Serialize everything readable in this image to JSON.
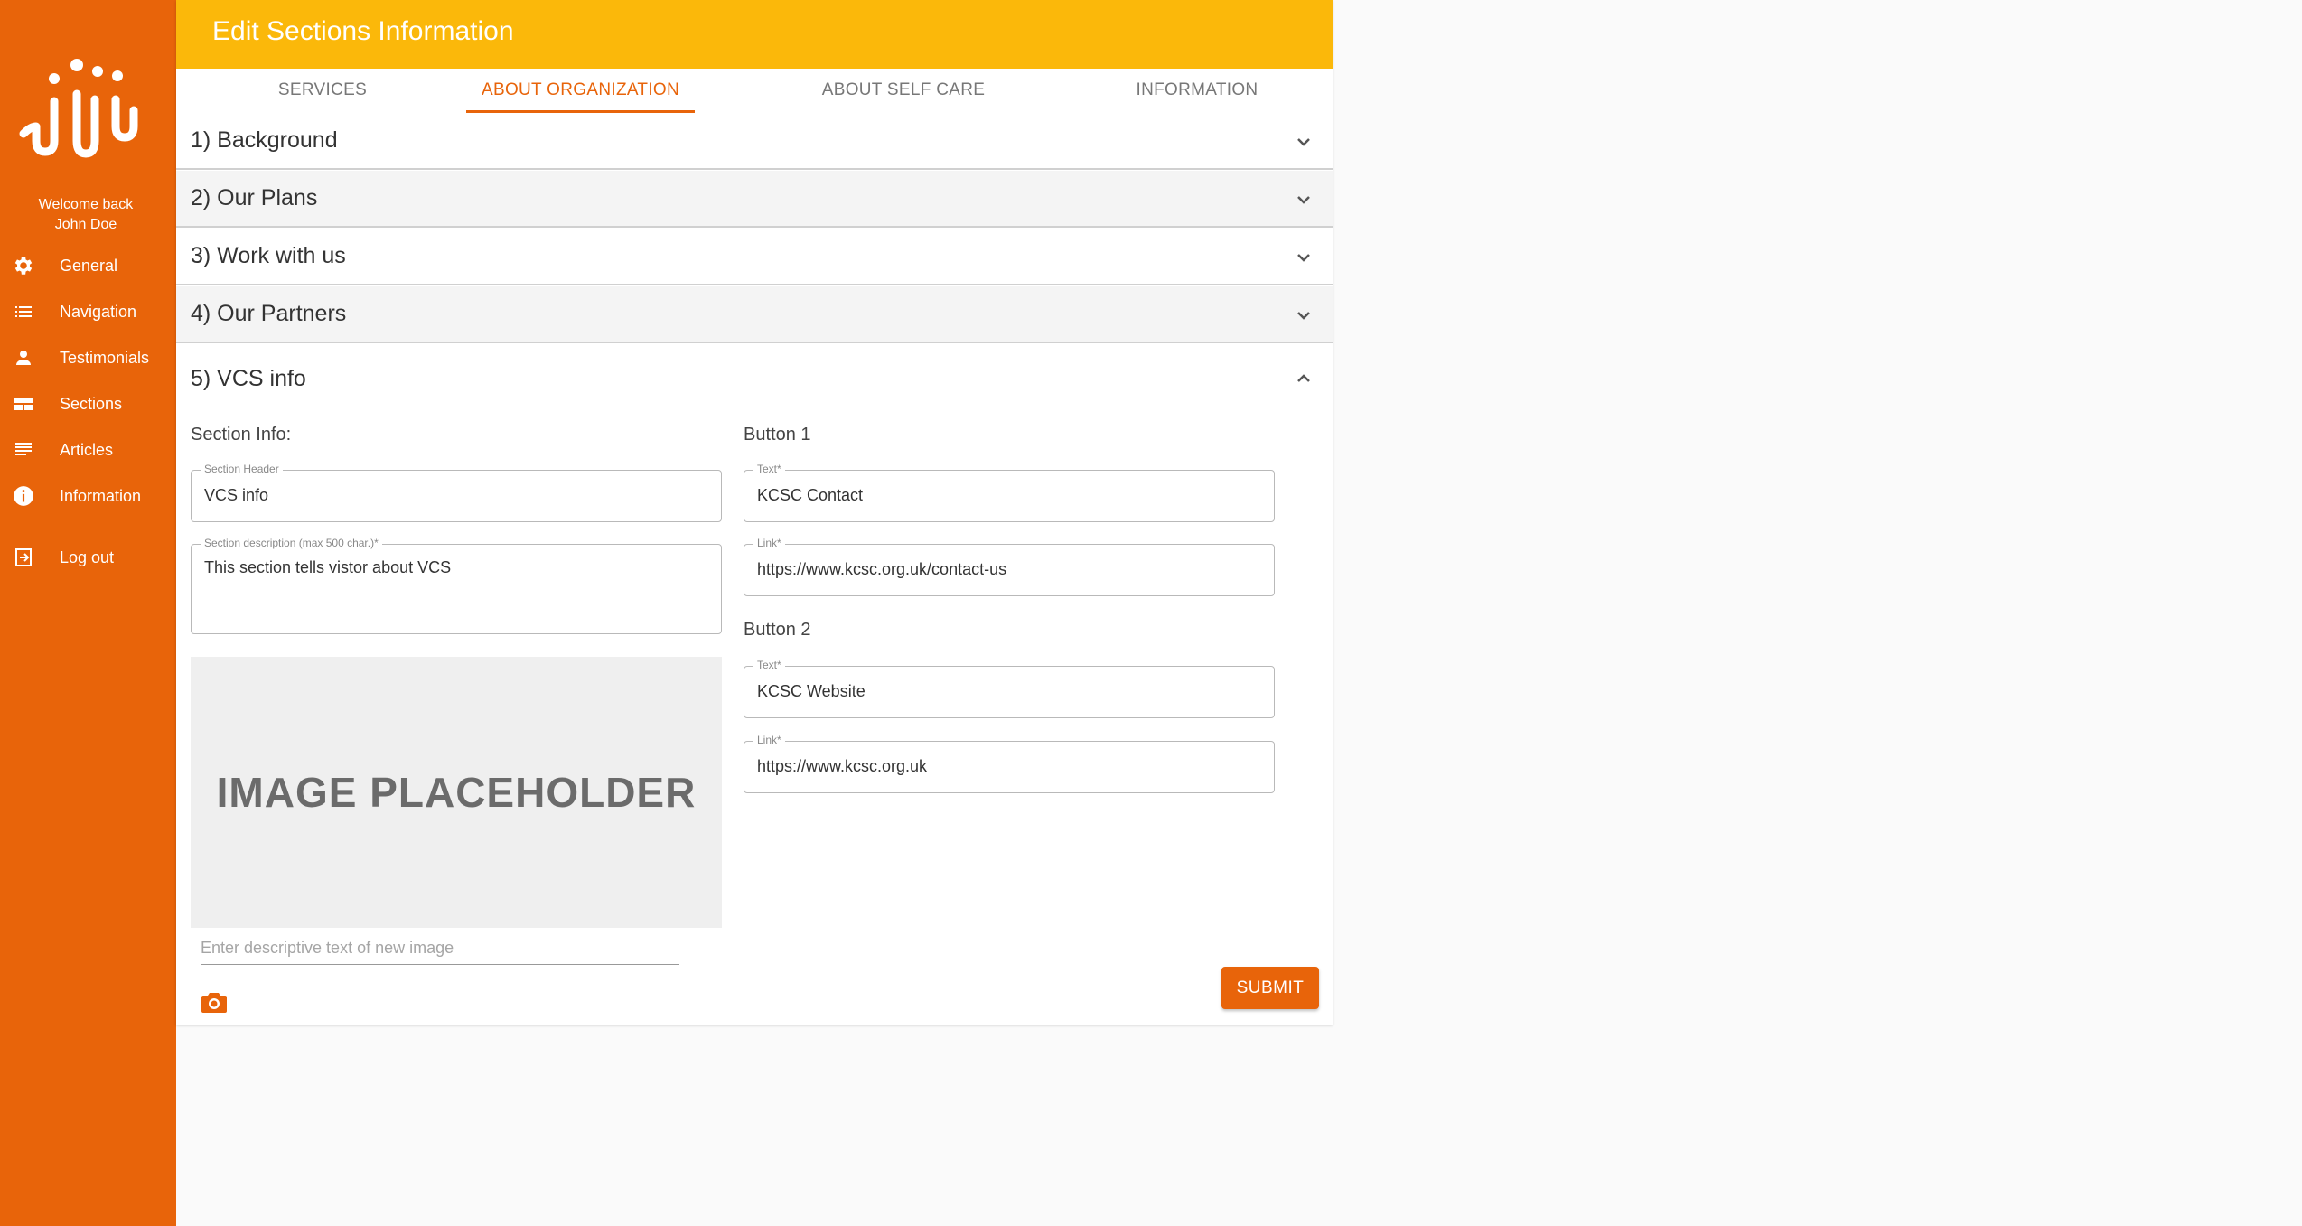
{
  "sidebar": {
    "welcome_line1": "Welcome back",
    "welcome_line2": "John Doe",
    "items": [
      {
        "label": "General",
        "icon": "gear-icon"
      },
      {
        "label": "Navigation",
        "icon": "list-icon"
      },
      {
        "label": "Testimonials",
        "icon": "person-icon"
      },
      {
        "label": "Sections",
        "icon": "sections-icon"
      },
      {
        "label": "Articles",
        "icon": "article-icon"
      },
      {
        "label": "Information",
        "icon": "info-icon"
      }
    ],
    "logout_label": "Log out"
  },
  "header": {
    "title": "Edit Sections Information"
  },
  "tabs": [
    {
      "label": "SERVICES",
      "active": false
    },
    {
      "label": "ABOUT ORGANIZATION",
      "active": true
    },
    {
      "label": "ABOUT SELF CARE",
      "active": false
    },
    {
      "label": "INFORMATION",
      "active": false
    }
  ],
  "accordion": [
    {
      "title": "1) Background",
      "expanded": false
    },
    {
      "title": "2) Our Plans",
      "expanded": false
    },
    {
      "title": "3) Work with us",
      "expanded": false
    },
    {
      "title": "4) Our Partners",
      "expanded": false
    },
    {
      "title": "5) VCS info",
      "expanded": true
    }
  ],
  "section_form": {
    "section_info_label": "Section Info:",
    "header_field": {
      "label": "Section Header",
      "value": "VCS info"
    },
    "description_field": {
      "label": "Section description (max 500 char.)*",
      "value": "This section tells vistor about VCS"
    },
    "image_placeholder_text": "IMAGE PLACEHOLDER",
    "image_desc_placeholder": "Enter descriptive text of new image",
    "button1": {
      "heading": "Button 1",
      "text_label": "Text*",
      "text_value": "KCSC Contact",
      "link_label": "Link*",
      "link_value": "https://www.kcsc.org.uk/contact-us"
    },
    "button2": {
      "heading": "Button 2",
      "text_label": "Text*",
      "text_value": "KCSC Website",
      "link_label": "Link*",
      "link_value": "https://www.kcsc.org.uk"
    },
    "submit_label": "SUBMIT"
  },
  "colors": {
    "primary_orange": "#e8640a",
    "header_yellow": "#fbb80a"
  }
}
